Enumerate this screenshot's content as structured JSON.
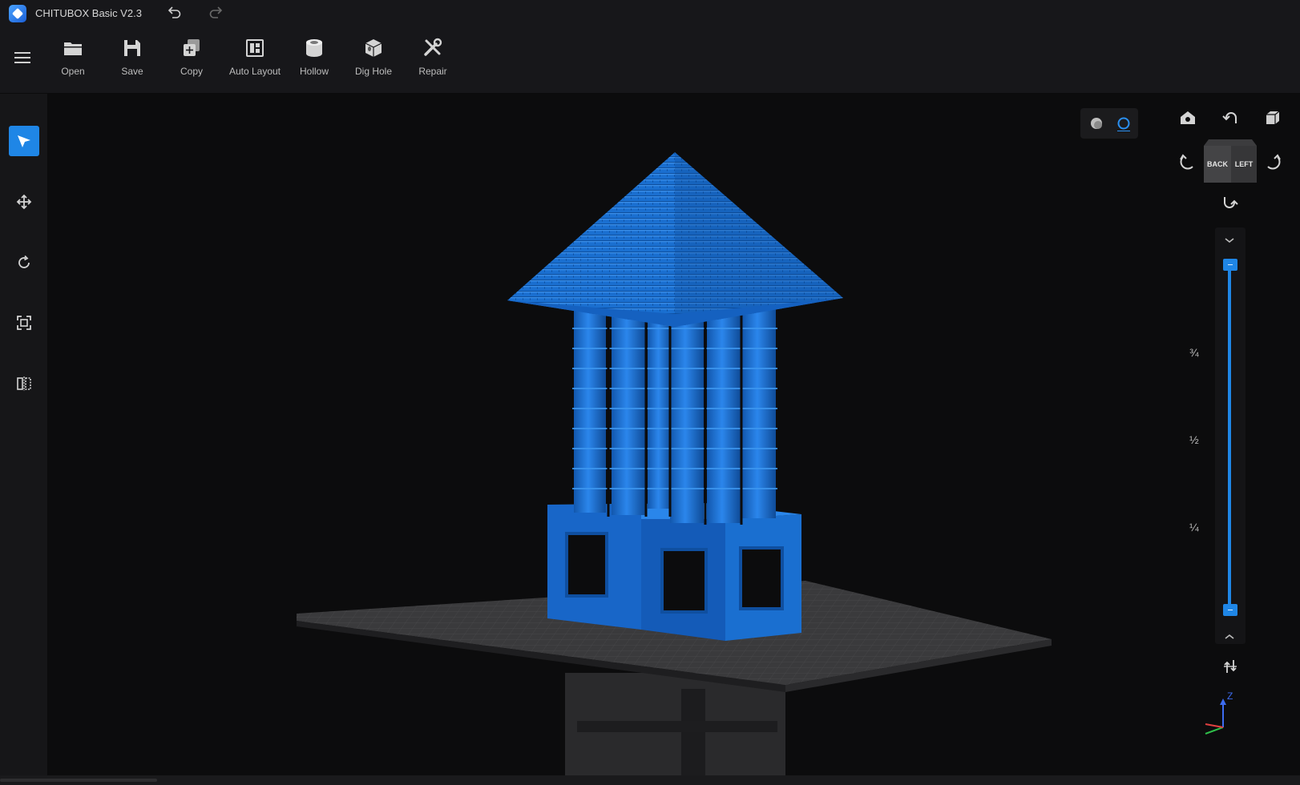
{
  "app": {
    "title": "CHITUBOX Basic V2.3"
  },
  "toolbar": {
    "items": [
      {
        "label": "Open",
        "icon": "folder-icon"
      },
      {
        "label": "Save",
        "icon": "floppy-icon"
      },
      {
        "label": "Copy",
        "icon": "copy-icon"
      },
      {
        "label": "Auto Layout",
        "icon": "auto-layout-icon"
      },
      {
        "label": "Hollow",
        "icon": "hollow-icon"
      },
      {
        "label": "Dig Hole",
        "icon": "dig-hole-icon"
      },
      {
        "label": "Repair",
        "icon": "repair-icon"
      }
    ]
  },
  "sidebar": {
    "tools": [
      {
        "name": "select",
        "icon": "select-cursor-icon",
        "active": true
      },
      {
        "name": "move",
        "icon": "move-arrows-icon",
        "active": false
      },
      {
        "name": "rotate",
        "icon": "rotate-icon",
        "active": false
      },
      {
        "name": "scale",
        "icon": "scale-icon",
        "active": false
      },
      {
        "name": "mirror",
        "icon": "mirror-icon",
        "active": false
      }
    ]
  },
  "viewcube": {
    "face_left": "BACK",
    "face_right": "LEFT"
  },
  "layer_slider": {
    "marks": [
      "¾",
      "½",
      "¼"
    ],
    "upper_value": 1.0,
    "lower_value": 0.0
  },
  "axis_gizmo": {
    "z_label": "Z"
  },
  "colors": {
    "accent": "#1f86e6",
    "model": "#1a6fd0",
    "plate": "#3a3a3c"
  }
}
